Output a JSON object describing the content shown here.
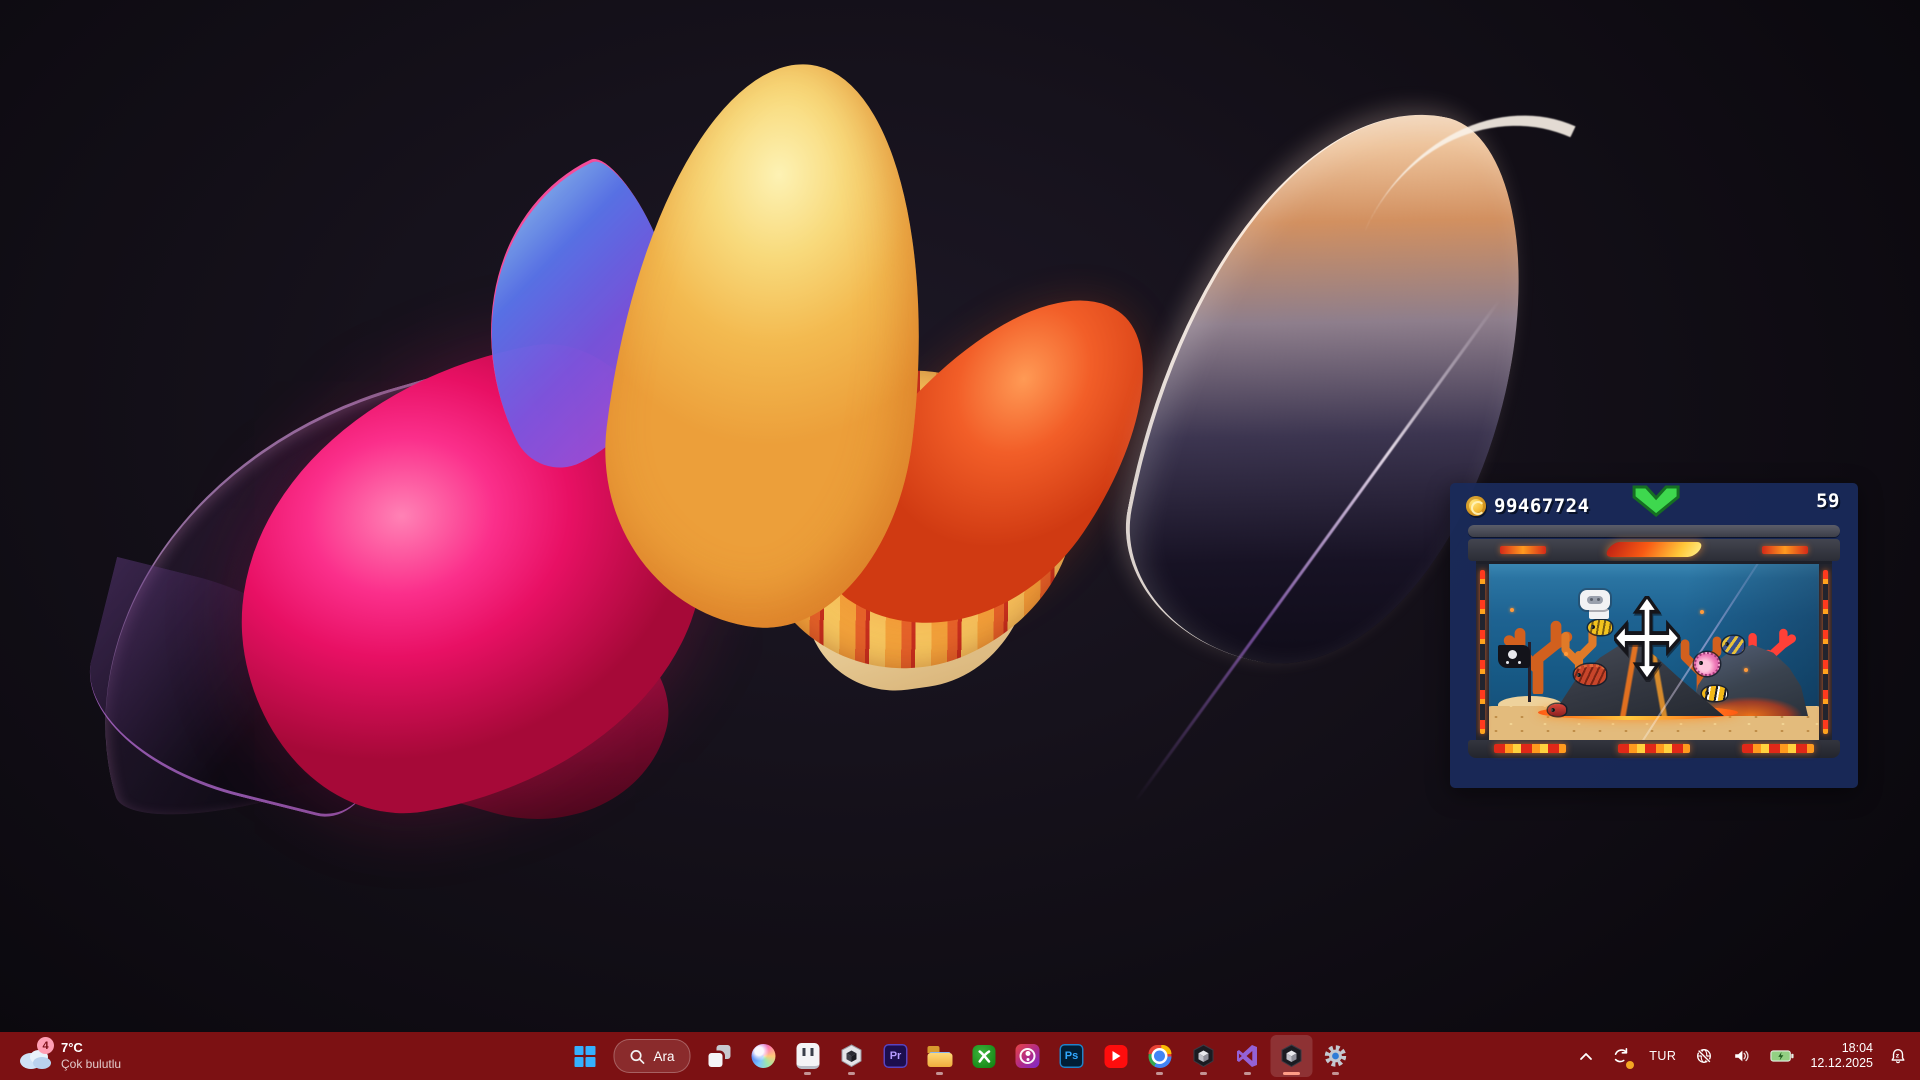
{
  "wallpaper": {
    "description": "abstract 3d flower petals on dark background",
    "colors": {
      "background": "#0c0a10",
      "pink": "#fb2f8b",
      "yellow": "#f3ba50",
      "orange": "#f25e28",
      "purple": "#7a55e0",
      "glass": "#f7ecdf"
    }
  },
  "widget": {
    "coin_count": "99467724",
    "fish_count": "59",
    "panel_color": "#1a2a5a",
    "chevron_color": "#3ed84e",
    "icons": [
      "coin-icon",
      "chevron-down-icon",
      "move-cursor-icon",
      "thought-bubble-controller-icon"
    ]
  },
  "taskbar": {
    "background": "#7c1113",
    "weather": {
      "badge": "4",
      "temperature": "7°C",
      "condition": "Çok bulutlu"
    },
    "search": {
      "label": "Ara"
    },
    "apps": [
      {
        "name": "start-button"
      },
      {
        "name": "search"
      },
      {
        "name": "task-view"
      },
      {
        "name": "copilot"
      },
      {
        "name": "pixel-game",
        "running": true
      },
      {
        "name": "unity-hub",
        "running": true
      },
      {
        "name": "premiere-pro",
        "label": "Pr",
        "running": false
      },
      {
        "name": "file-explorer",
        "running": true
      },
      {
        "name": "xbox",
        "running": false
      },
      {
        "name": "profile-app",
        "running": false
      },
      {
        "name": "photoshop",
        "label": "Ps",
        "running": false
      },
      {
        "name": "youtube",
        "running": false
      },
      {
        "name": "chrome",
        "running": true
      },
      {
        "name": "unity-editor",
        "running": true
      },
      {
        "name": "visual-studio",
        "running": true
      },
      {
        "name": "unity-editor-active",
        "running": true,
        "active": true
      },
      {
        "name": "settings",
        "running": true
      }
    ],
    "tray": {
      "language": "TUR",
      "time": "18:04",
      "date": "12.12.2025",
      "icons": [
        "chevron-up-icon",
        "sync-icon",
        "globe-offline-icon",
        "volume-icon",
        "battery-charging-icon",
        "bell-dnd-icon"
      ]
    }
  }
}
